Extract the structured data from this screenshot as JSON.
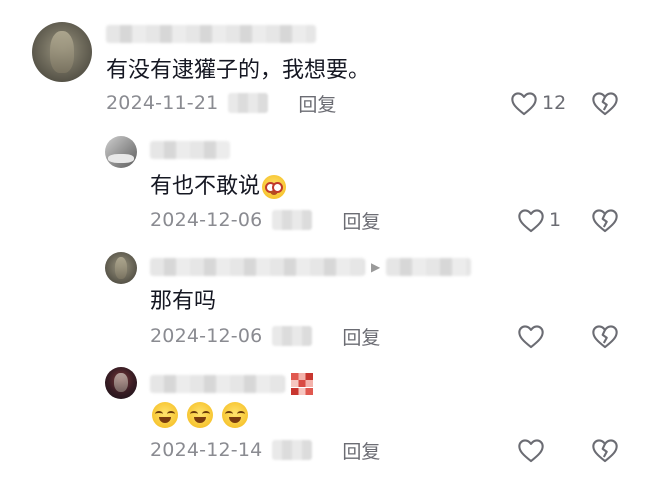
{
  "comments": [
    {
      "text": "有没有逮獾子的，我想要。",
      "date": "2024-11-21",
      "reply_label": "回复",
      "like_count": "12"
    },
    {
      "text": "有也不敢说",
      "date": "2024-12-06",
      "reply_label": "回复",
      "like_count": "1"
    },
    {
      "text": "那有吗",
      "date": "2024-12-06",
      "reply_label": "回复",
      "like_count": ""
    },
    {
      "text": "",
      "date": "2024-12-14",
      "reply_label": "回复",
      "like_count": ""
    }
  ],
  "icons": {
    "like": "heart-outline-icon",
    "dislike": "broken-heart-icon",
    "reply_arrow": "play-arrow-icon"
  },
  "colors": {
    "text": "#161823",
    "meta": "#8a8b91",
    "icon": "#6b6c73"
  }
}
